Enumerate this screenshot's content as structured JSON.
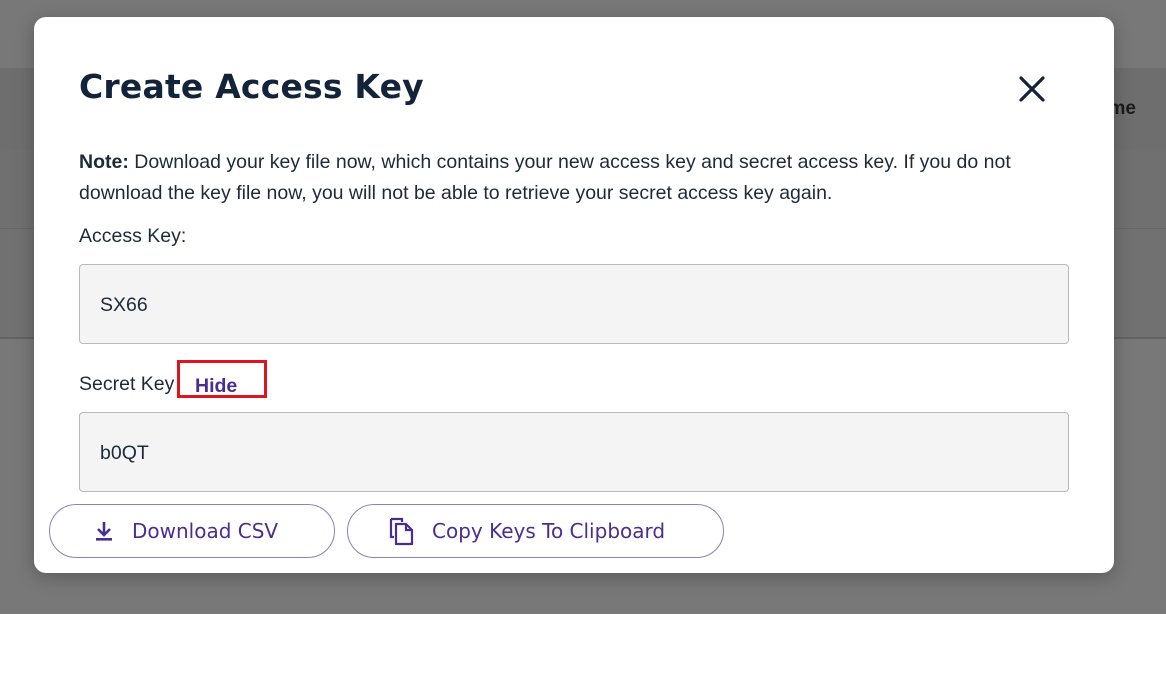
{
  "background": {
    "header_partial_text": "me"
  },
  "modal": {
    "title": "Create Access Key",
    "close_icon": "close-icon",
    "note": {
      "label": "Note:",
      "text": " Download your key file now, which contains your new access key and secret access key. If you do not download the key file now, you will not be able to retrieve your secret access key again."
    },
    "access_key": {
      "label": "Access Key:",
      "value": "SX66"
    },
    "secret_key": {
      "label": "Secret Key",
      "toggle_label": "Hide",
      "value": "b0QT"
    },
    "actions": {
      "download_label": "Download CSV",
      "download_icon": "download-icon",
      "copy_label": "Copy Keys To Clipboard",
      "copy_icon": "copy-icon"
    }
  },
  "colors": {
    "accent": "#4b2d8f",
    "title": "#13243a",
    "highlight_box": "#e0141e",
    "input_bg": "#f4f4f4",
    "overlay": "#787878"
  }
}
